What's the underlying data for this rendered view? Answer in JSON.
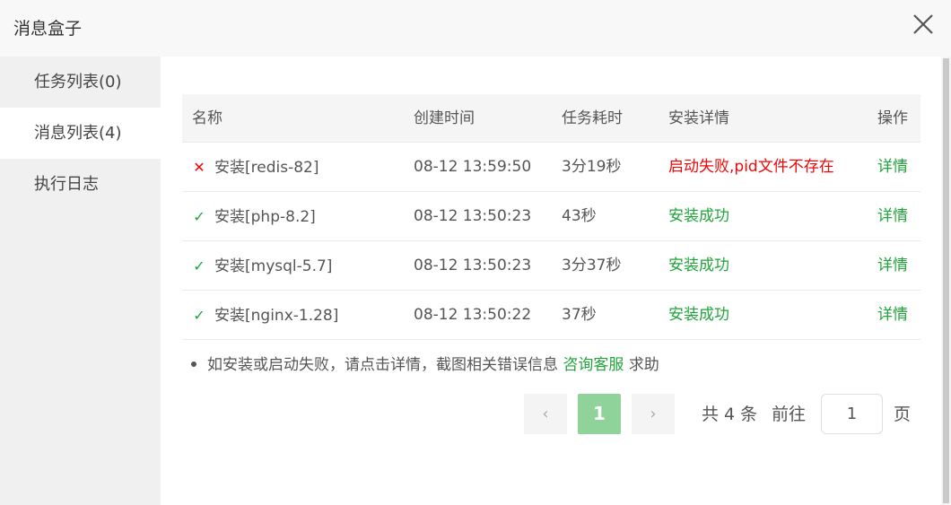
{
  "dialog": {
    "title": "消息盒子"
  },
  "sidebar": {
    "items": [
      {
        "label": "任务列表(0)",
        "active": false
      },
      {
        "label": "消息列表(4)",
        "active": true
      },
      {
        "label": "执行日志",
        "active": false
      }
    ]
  },
  "table": {
    "columns": [
      "名称",
      "创建时间",
      "任务耗时",
      "安装详情",
      "操作"
    ],
    "rows": [
      {
        "status_icon": "cross-icon",
        "name": "安装[redis-82]",
        "created": "08-12 13:59:50",
        "duration": "3分19秒",
        "detail": "启动失败,pid文件不存在",
        "detail_state": "fail",
        "action": "详情"
      },
      {
        "status_icon": "check-icon",
        "name": "安装[php-8.2]",
        "created": "08-12 13:50:23",
        "duration": "43秒",
        "detail": "安装成功",
        "detail_state": "ok",
        "action": "详情"
      },
      {
        "status_icon": "check-icon",
        "name": "安装[mysql-5.7]",
        "created": "08-12 13:50:23",
        "duration": "3分37秒",
        "detail": "安装成功",
        "detail_state": "ok",
        "action": "详情"
      },
      {
        "status_icon": "check-icon",
        "name": "安装[nginx-1.28]",
        "created": "08-12 13:50:22",
        "duration": "37秒",
        "detail": "安装成功",
        "detail_state": "ok",
        "action": "详情"
      }
    ]
  },
  "hint": {
    "text": "如安装或启动失败，请点击详情，截图相关错误信息",
    "link": "咨询客服",
    "suffix": "求助"
  },
  "pagination": {
    "prev": "‹",
    "next": "›",
    "current_page": "1",
    "total_label": "共 4 条",
    "goto_label": "前往",
    "goto_value": "1",
    "page_suffix": "页"
  },
  "colors": {
    "success": "#20a53a",
    "error": "#ef0808",
    "active_page": "#8fd39b"
  }
}
